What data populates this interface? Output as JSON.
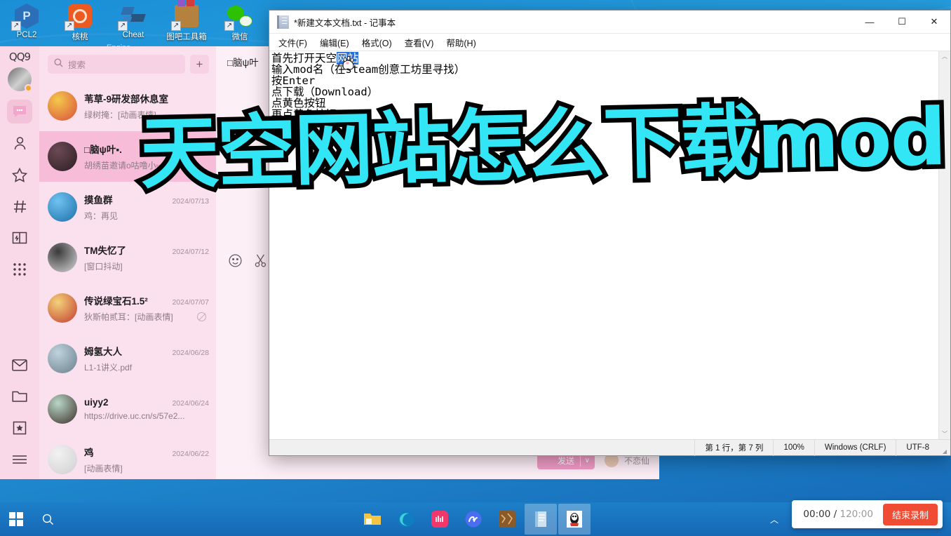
{
  "desktop": {
    "icons": [
      {
        "label": "PCL2",
        "icon": "pcl2-launcher-icon",
        "badge": "P"
      },
      {
        "label": "核桃",
        "icon": "hetao-app-icon",
        "badge": ""
      },
      {
        "label": "Cheat",
        "icon": "cheat-engine-icon",
        "sub": "Engine",
        "badge": ""
      },
      {
        "label": "图吧工具箱",
        "icon": "tuba-toolbox-icon",
        "badge": ""
      },
      {
        "label": "微信",
        "icon": "wechat-icon",
        "badge": ""
      }
    ]
  },
  "qq": {
    "logo": "QQ9",
    "search": {
      "placeholder": "搜索",
      "icon": "search-icon"
    },
    "add_label": "+",
    "rail": [
      {
        "name": "messages",
        "icon": "chat-bubble-icon",
        "active": true
      },
      {
        "name": "contacts",
        "icon": "person-icon",
        "active": false
      },
      {
        "name": "favorites",
        "icon": "star-icon",
        "active": false
      },
      {
        "name": "channels",
        "icon": "hash-icon",
        "active": false
      },
      {
        "name": "zone",
        "icon": "book-icon",
        "active": false
      },
      {
        "name": "apps",
        "icon": "grid-dots-icon",
        "active": false
      },
      {
        "name": "mail",
        "icon": "envelope-icon",
        "active": false
      },
      {
        "name": "files",
        "icon": "folder-icon",
        "active": false
      },
      {
        "name": "collection",
        "icon": "bookmark-icon",
        "active": false
      },
      {
        "name": "menu",
        "icon": "hamburger-icon",
        "active": false
      }
    ],
    "chats": [
      {
        "name": "苇草-9研发部休息室",
        "msg": "绿树掩：[动画表情]",
        "time": "",
        "selected": false,
        "muted": false,
        "avatar_a": "#f4c84a",
        "avatar_b": "#d94f3d"
      },
      {
        "name": "□脑ψ叶▪.",
        "msg": "胡绣苗邀请o咕噜小▫▫▫",
        "time": "",
        "selected": true,
        "muted": false,
        "avatar_a": "#6b4a55",
        "avatar_b": "#2b1d22"
      },
      {
        "name": "摸鱼群",
        "msg": "鸡：再见",
        "time": "2024/07/13",
        "selected": false,
        "muted": false,
        "avatar_a": "#6fc3f0",
        "avatar_b": "#1c6ea8"
      },
      {
        "name": "TM失忆了",
        "msg": "[窗口抖动]",
        "time": "2024/07/12",
        "selected": false,
        "muted": false,
        "avatar_a": "#3a3a3a",
        "avatar_b": "#d8d8d8"
      },
      {
        "name": "传说绿宝石1.5²",
        "msg": "狄斯帕贰耳：[动画表情]",
        "time": "2024/07/07",
        "selected": false,
        "muted": true,
        "avatar_a": "#f3d27a",
        "avatar_b": "#c23b2e"
      },
      {
        "name": "姆氢大人",
        "msg": "L1-1讲义.pdf",
        "time": "2024/06/28",
        "selected": false,
        "muted": false,
        "avatar_a": "#bfd3de",
        "avatar_b": "#6b7f8c"
      },
      {
        "name": "uiyy2",
        "msg": "https://drive.uc.cn/s/57e2...",
        "time": "2024/06/24",
        "selected": false,
        "muted": false,
        "avatar_a": "#b9d6c6",
        "avatar_b": "#3c2f2a"
      },
      {
        "name": "鸡",
        "msg": "[动画表情]",
        "time": "2024/06/22",
        "selected": false,
        "muted": false,
        "avatar_a": "#f2f2f2",
        "avatar_b": "#cfcfcf"
      }
    ],
    "chat_header_title": "□脑ψ叶",
    "toolbar_icons": [
      "emoji-icon",
      "scissors-icon"
    ],
    "send_button": "发送",
    "send_caret": "∨",
    "footer_name": "不恋仙"
  },
  "notepad": {
    "title": "*新建文本文档.txt - 记事本",
    "icon": "notepad-icon",
    "window_controls": {
      "minimize": "—",
      "maximize": "☐",
      "close": "✕"
    },
    "menu": [
      "文件(F)",
      "编辑(E)",
      "格式(O)",
      "查看(V)",
      "帮助(H)"
    ],
    "lines": [
      {
        "before": "首先打开天空",
        "selected": "网站",
        "after": ""
      },
      {
        "before": "输入mod名（在steam创意工坊里寻找）",
        "selected": "",
        "after": ""
      },
      {
        "before": "按Enter",
        "selected": "",
        "after": ""
      },
      {
        "before": "点下载（Download）",
        "selected": "",
        "after": ""
      },
      {
        "before": "点黄色按钮",
        "selected": "",
        "after": ""
      },
      {
        "before": "再点黄色按钮",
        "selected": "",
        "after": ""
      }
    ],
    "status": {
      "position": "第 1 行，第 7 列",
      "zoom": "100%",
      "line_ending": "Windows (CRLF)",
      "encoding": "UTF-8"
    },
    "scroll": {
      "up": "︿",
      "down": "﹀"
    }
  },
  "overlay": {
    "text": "天空网站怎么下载mod",
    "fill_color": "#33e6f6",
    "stroke_color": "#000000"
  },
  "taskbar": {
    "start_icon": "windows-start-icon",
    "search_icon": "search-icon",
    "apps": [
      {
        "name": "file-explorer",
        "icon": "folder-icon",
        "active": false
      },
      {
        "name": "microsoft-edge",
        "icon": "edge-icon",
        "active": false
      },
      {
        "name": "music-app",
        "icon": "music-app-icon",
        "active": false
      },
      {
        "name": "netease-music",
        "icon": "netease-icon",
        "active": false
      },
      {
        "name": "game-app",
        "icon": "game-app-icon",
        "active": false
      },
      {
        "name": "notepad",
        "icon": "notepad-icon",
        "active": true
      },
      {
        "name": "qq",
        "icon": "qq-penguin-icon",
        "active": true
      }
    ],
    "tray": {
      "chevron": "︿"
    }
  },
  "recorder": {
    "elapsed": "00:00",
    "separator": "/",
    "total": "120:00",
    "stop_label": "结束录制",
    "stop_color": "#f04b33"
  }
}
